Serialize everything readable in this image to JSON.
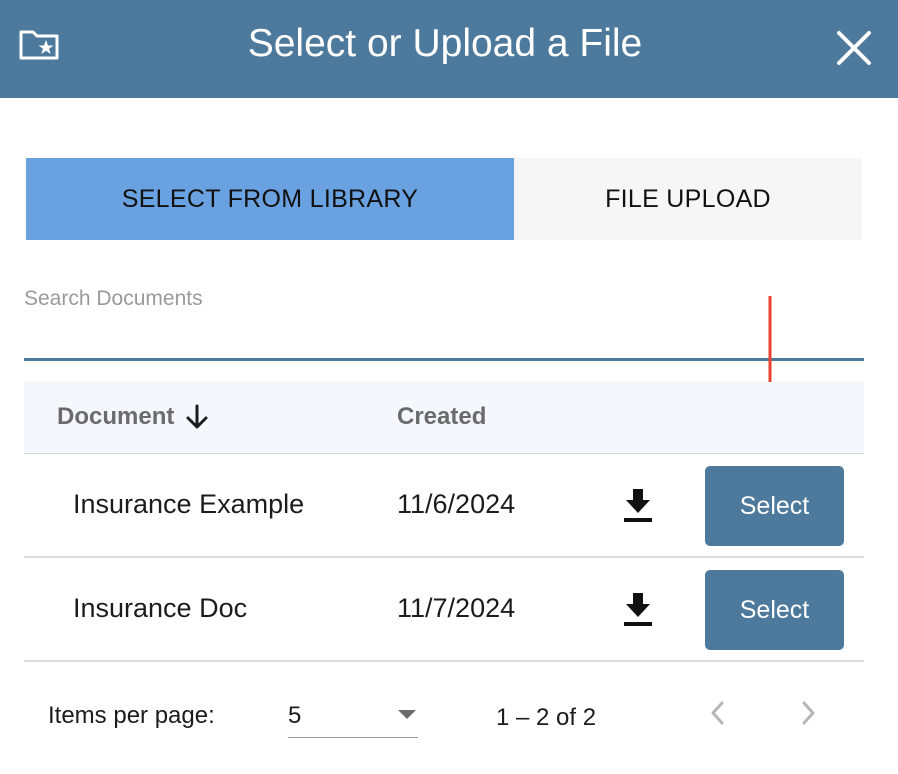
{
  "dialog": {
    "title": "Select or Upload a File",
    "icons": {
      "folder": "folder-star-icon",
      "close": "close-icon"
    }
  },
  "tabs": [
    {
      "label": "SELECT FROM LIBRARY",
      "active": true
    },
    {
      "label": "FILE UPLOAD",
      "active": false
    }
  ],
  "search": {
    "placeholder": "Search Documents",
    "value": ""
  },
  "table": {
    "columns": {
      "document": "Document",
      "created": "Created"
    },
    "sort_icon": "arrow-down-icon",
    "rows": [
      {
        "name": "Insurance Example",
        "created": "11/6/2024",
        "action": "Select"
      },
      {
        "name": "Insurance Doc",
        "created": "11/7/2024",
        "action": "Select"
      }
    ]
  },
  "paginator": {
    "items_per_page_label": "Items per page:",
    "items_per_page": "5",
    "range": "1 – 2 of 2"
  },
  "colors": {
    "header": "#4d7a9c",
    "active_tab": "#6aa2e1",
    "button": "#4d7a9c",
    "annotation_arrow": "#e8432e"
  }
}
